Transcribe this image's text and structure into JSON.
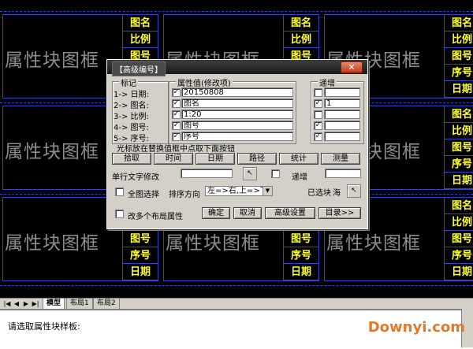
{
  "block_text": "属性块图框",
  "block_cells": [
    "图名",
    "比例",
    "图号",
    "序号",
    "日期"
  ],
  "dialog": {
    "title": "【高级编号】",
    "close_label": "✕",
    "group_labels": {
      "label": "标记",
      "value": "属性值(修改项)",
      "increment": "递增"
    },
    "rows": [
      {
        "label": "1-> 日期:",
        "checked": "✓",
        "value": "20150808",
        "inc_checked": "",
        "inc_value": ""
      },
      {
        "label": "2-> 图名:",
        "checked": "✓",
        "value": "图名",
        "inc_checked": "✓",
        "inc_value": "1"
      },
      {
        "label": "3-> 比例:",
        "checked": "✓",
        "value": "1:20",
        "inc_checked": "",
        "inc_value": ""
      },
      {
        "label": "4-> 图号:",
        "checked": "✓",
        "value": "图号",
        "inc_checked": "✓",
        "inc_value": ""
      },
      {
        "label": "5-> 序号:",
        "checked": "✓",
        "value": "序号",
        "inc_checked": "✓",
        "inc_value": ""
      }
    ],
    "pick_hint": "光标放在替换值框中点取下面按钮",
    "pick_buttons": [
      "拾取",
      "时间",
      "日期",
      "路径",
      "统计",
      "测量"
    ],
    "single_edit_label": "单行文字修改",
    "single_inc_label": "递增",
    "full_select_label": "全图选择",
    "order_label": "排序方向",
    "order_value": "左=>右,上=>下",
    "selected_label": "已选块",
    "selected_count": "海",
    "multi_layout_label": "改多个布局属性",
    "ok_label": "确定",
    "cancel_label": "取消",
    "advanced_label": "高级设置",
    "catalog_label": "目录>>"
  },
  "tabs": [
    "模型",
    "布局1",
    "布局2"
  ],
  "command_prompt": "请选取属性块样板:",
  "watermark": "Downyi.com"
}
